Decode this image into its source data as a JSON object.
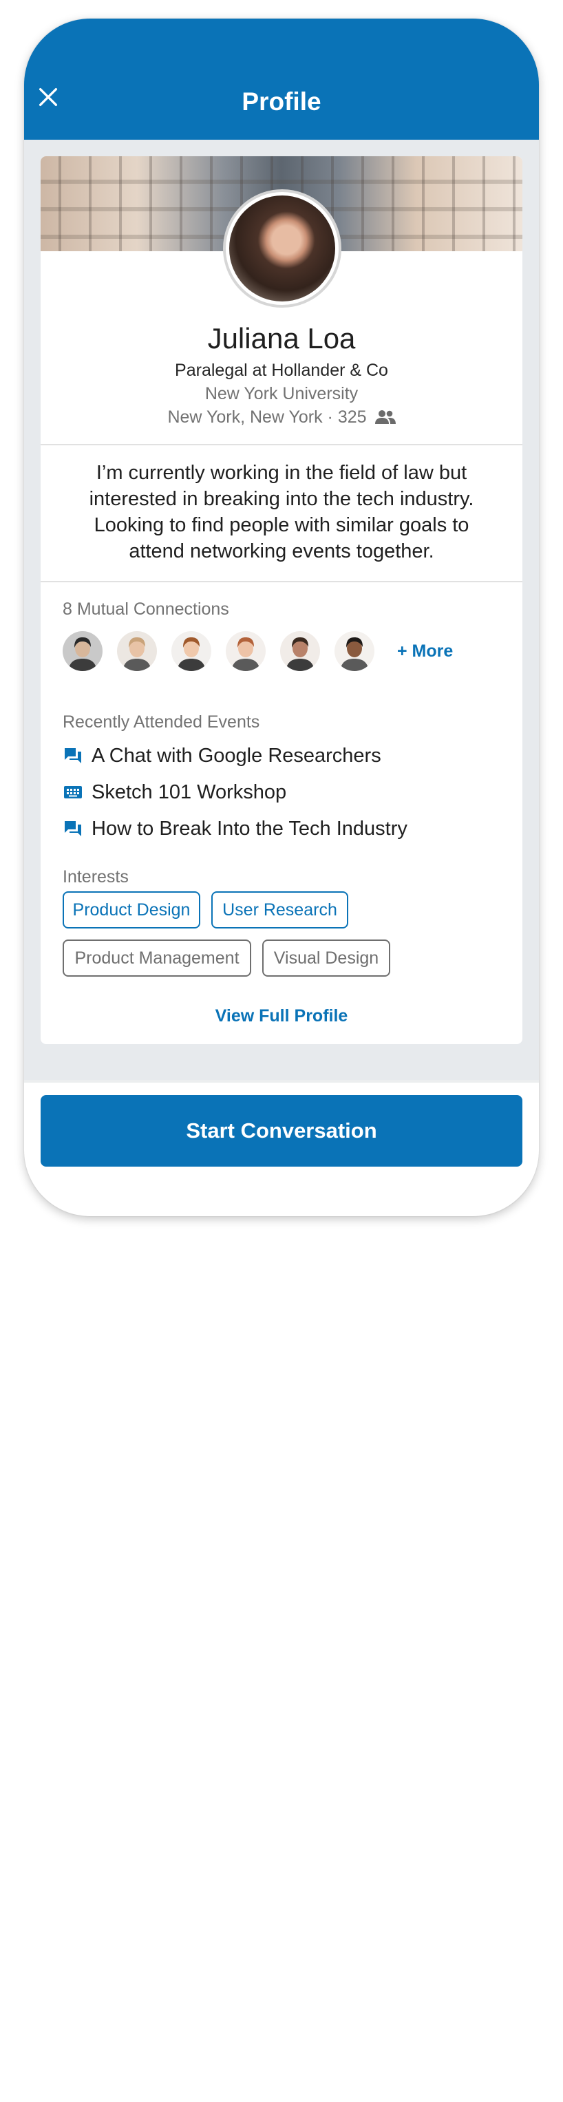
{
  "header": {
    "title": "Profile",
    "close_icon": "close-icon",
    "color": "#0a73b7"
  },
  "profile": {
    "name": "Juliana Loa",
    "headline": "Paralegal at Hollander & Co",
    "school": "New York University",
    "location": "New York, New York",
    "connections": "325",
    "connections_icon": "people-icon",
    "about": "I’m currently working in the field of law but interested in breaking into the tech industry. Looking to find people with similar goals to attend networking events together."
  },
  "mutual": {
    "label": "8 Mutual Connections",
    "more_label": "+ More",
    "avatars": [
      {
        "icon": "person-avatar-icon",
        "bg": "#c9c9c9",
        "skin": "#d8b79b",
        "hair": "#2a2a2a"
      },
      {
        "icon": "person-avatar-icon",
        "bg": "#ece7e2",
        "skin": "#e8c3a6",
        "hair": "#c9a37a"
      },
      {
        "icon": "person-avatar-icon",
        "bg": "#f2f0ee",
        "skin": "#f0c9ac",
        "hair": "#a05a2c"
      },
      {
        "icon": "person-avatar-icon",
        "bg": "#f3efec",
        "skin": "#eec3a7",
        "hair": "#b3623a"
      },
      {
        "icon": "person-avatar-icon",
        "bg": "#f1ece8",
        "skin": "#b8826a",
        "hair": "#3a2a20"
      },
      {
        "icon": "person-avatar-icon",
        "bg": "#f4f1ee",
        "skin": "#8a5a3e",
        "hair": "#1e1a18"
      }
    ]
  },
  "events": {
    "label": "Recently Attended Events",
    "items": [
      {
        "icon": "chat-icon",
        "title": "A Chat with Google Researchers"
      },
      {
        "icon": "keyboard-icon",
        "title": "Sketch 101 Workshop"
      },
      {
        "icon": "chat-icon",
        "title": "How to Break Into the Tech Industry"
      }
    ]
  },
  "interests": {
    "label": "Interests",
    "items": [
      {
        "label": "Product Design",
        "selected": true
      },
      {
        "label": "User Research",
        "selected": true
      },
      {
        "label": "Product Management",
        "selected": false
      },
      {
        "label": "Visual Design",
        "selected": false
      }
    ]
  },
  "view_full_profile": "View Full Profile",
  "cta": "Start Conversation"
}
